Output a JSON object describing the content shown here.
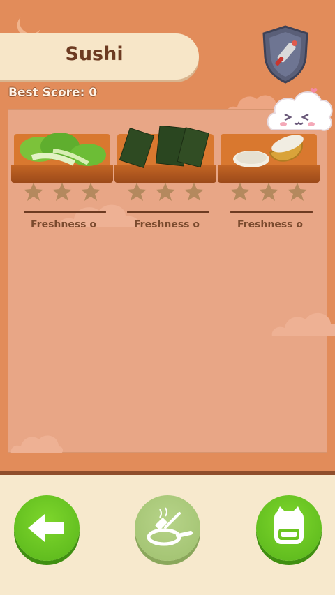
{
  "title": "Sushi",
  "best_score_label": "Best Score: 0",
  "ingredients": [
    {
      "name": "bok-choy",
      "freshness_label": "Freshness o",
      "stars": 3
    },
    {
      "name": "nori",
      "freshness_label": "Freshness o",
      "stars": 3
    },
    {
      "name": "rice",
      "freshness_label": "Freshness o",
      "stars": 3
    }
  ],
  "buttons": {
    "back": {
      "icon": "arrow-left-icon",
      "enabled": true
    },
    "cook": {
      "icon": "frying-pan-icon",
      "enabled": false
    },
    "bag": {
      "icon": "backpack-icon",
      "enabled": true
    }
  },
  "colors": {
    "background": "#e28c5a",
    "panel": "#e8a686",
    "accent_green": "#6cc520",
    "title_text": "#6d3b22"
  }
}
